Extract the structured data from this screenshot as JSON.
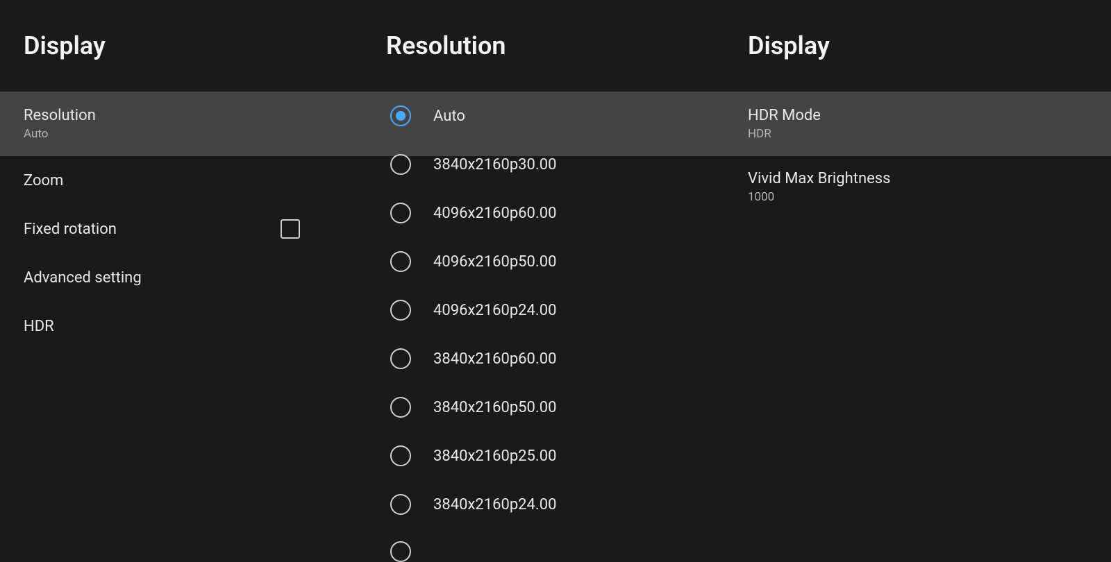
{
  "left": {
    "title": "Display",
    "items": [
      {
        "label": "Resolution",
        "sub": "Auto"
      },
      {
        "label": "Zoom"
      },
      {
        "label": "Fixed rotation"
      },
      {
        "label": "Advanced setting"
      },
      {
        "label": "HDR"
      }
    ]
  },
  "middle": {
    "title": "Resolution",
    "options": [
      {
        "label": "Auto",
        "selected": true
      },
      {
        "label": "3840x2160p30.00",
        "selected": false
      },
      {
        "label": "4096x2160p60.00",
        "selected": false
      },
      {
        "label": "4096x2160p50.00",
        "selected": false
      },
      {
        "label": "4096x2160p24.00",
        "selected": false
      },
      {
        "label": "3840x2160p60.00",
        "selected": false
      },
      {
        "label": "3840x2160p50.00",
        "selected": false
      },
      {
        "label": "3840x2160p25.00",
        "selected": false
      },
      {
        "label": "3840x2160p24.00",
        "selected": false
      }
    ]
  },
  "right": {
    "title": "Display",
    "items": [
      {
        "label": "HDR Mode",
        "sub": "HDR"
      },
      {
        "label": "Vivid Max Brightness",
        "sub": "1000"
      }
    ]
  }
}
